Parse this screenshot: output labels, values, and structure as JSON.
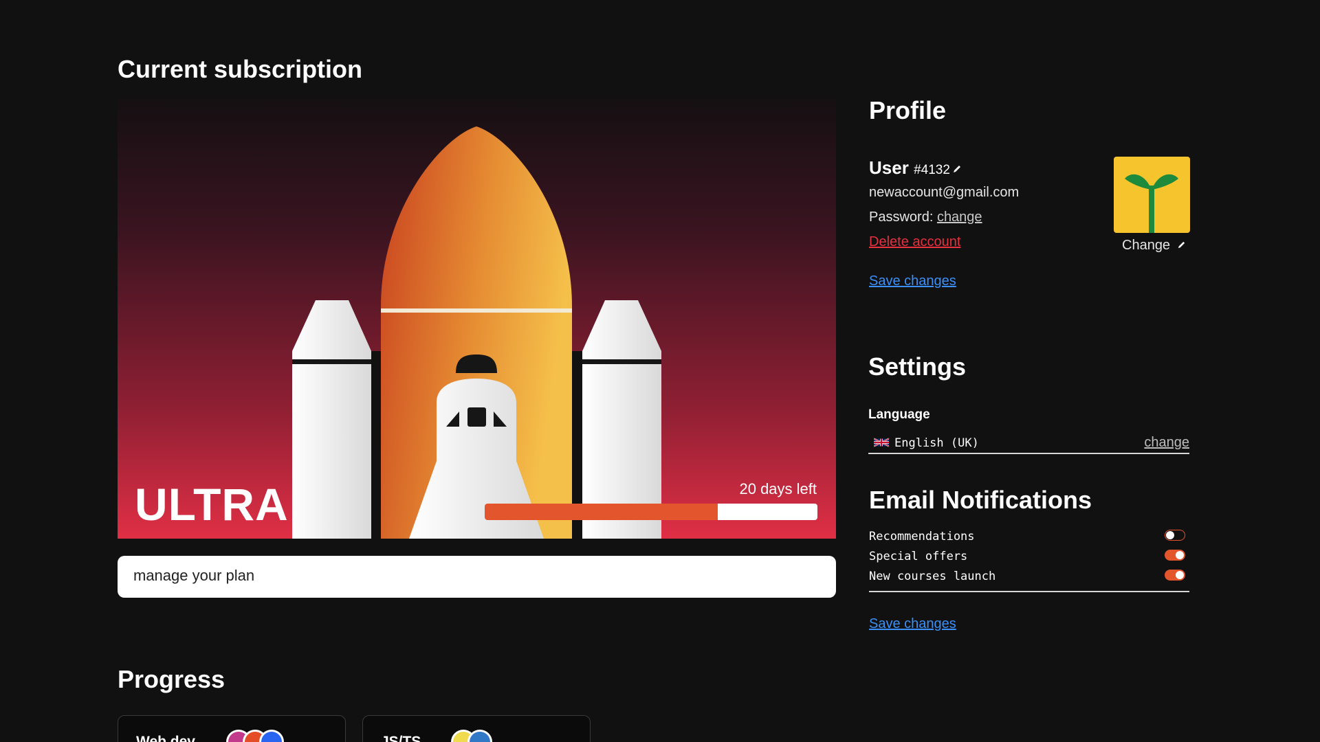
{
  "subscription": {
    "heading": "Current subscription",
    "plan_name": "ULTRA",
    "days_left_label": "20 days left",
    "progress_fraction": 0.7,
    "manage_label": "manage your plan"
  },
  "progress": {
    "heading": "Progress",
    "courses": [
      {
        "name": "Web dev",
        "badges": [
          "",
          "",
          ""
        ]
      },
      {
        "name": "JS/TS",
        "badges": [
          "",
          ""
        ]
      }
    ]
  },
  "profile": {
    "heading": "Profile",
    "user_label": "User",
    "user_id": "#4132",
    "email": "newaccount@gmail.com",
    "password_label": "Password:",
    "password_change": "change",
    "delete_account": "Delete account",
    "avatar_change": "Change",
    "save_changes": "Save changes"
  },
  "settings": {
    "heading": "Settings",
    "language_label": "Language",
    "language_value": "English (UK)",
    "language_change": "change"
  },
  "notifications": {
    "heading": "Email Notifications",
    "items": [
      {
        "label": "Recommendations",
        "enabled": false
      },
      {
        "label": "Special offers",
        "enabled": true
      },
      {
        "label": "New courses launch",
        "enabled": true
      }
    ],
    "save_changes": "Save changes"
  },
  "colors": {
    "accent_orange": "#e2552d",
    "link_blue": "#3b8ff6",
    "danger_red": "#e8303e",
    "avatar_yellow": "#f6c42d",
    "plant_green": "#1e8a3c"
  },
  "icons": {
    "user_id_edit": "pencil-icon",
    "avatar_edit": "pencil-icon",
    "language_flag": "uk-flag-icon",
    "avatar": "plant-icon"
  }
}
